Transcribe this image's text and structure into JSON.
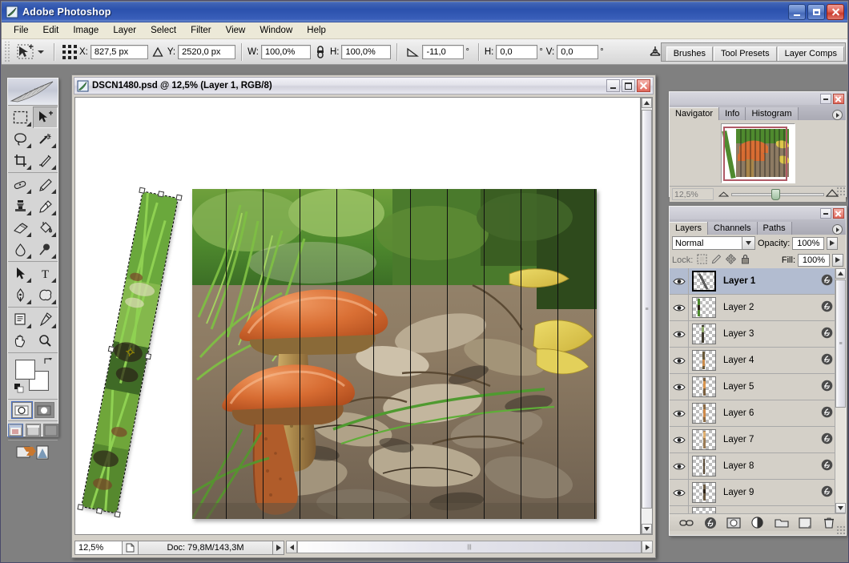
{
  "app": {
    "title": "Adobe Photoshop",
    "icon": "photoshop-feather-icon",
    "window_buttons": {
      "minimize": "_",
      "maximize": "□",
      "close": "✕"
    }
  },
  "menubar": {
    "items": [
      {
        "label": "File"
      },
      {
        "label": "Edit"
      },
      {
        "label": "Image"
      },
      {
        "label": "Layer"
      },
      {
        "label": "Select"
      },
      {
        "label": "Filter"
      },
      {
        "label": "View"
      },
      {
        "label": "Window"
      },
      {
        "label": "Help"
      }
    ]
  },
  "options_bar": {
    "tool_icon": "move-transform-tool-icon",
    "reference_point_icon": "reference-point-grid-icon",
    "x_label": "X:",
    "x_value": "827,5 px",
    "delta_icon": "delta-triangle-icon",
    "y_label": "Y:",
    "y_value": "2520,0 px",
    "w_label": "W:",
    "w_value": "100,0%",
    "link_icon": "chain-link-icon",
    "h_label": "H:",
    "h_value": "100,0%",
    "angle_icon": "rotate-angle-icon",
    "angle_value": "-11,0",
    "angle_unit": "°",
    "skew_h_label": "H:",
    "skew_h_value": "0,0",
    "skew_h_unit": "°",
    "skew_v_label": "V:",
    "skew_v_value": "0,0",
    "skew_v_unit": "°",
    "warp_icon": "warp-mode-icon",
    "cancel_icon": "cancel-transform-icon",
    "commit_icon": "commit-transform-icon",
    "imageready_icon": "jump-to-imageready-icon"
  },
  "palette_well": {
    "tabs": [
      {
        "label": "Brushes"
      },
      {
        "label": "Tool Presets"
      },
      {
        "label": "Layer Comps"
      }
    ]
  },
  "toolbox": {
    "logo_icon": "feather-logo-icon",
    "groups": [
      {
        "tools": [
          {
            "icon": "marquee-tool-icon",
            "selected": false
          },
          {
            "icon": "move-tool-icon",
            "selected": true
          },
          {
            "icon": "lasso-tool-icon",
            "selected": false
          },
          {
            "icon": "magic-wand-tool-icon",
            "selected": false
          },
          {
            "icon": "crop-tool-icon",
            "selected": false
          },
          {
            "icon": "slice-tool-icon",
            "selected": false
          }
        ]
      },
      {
        "tools": [
          {
            "icon": "healing-brush-tool-icon",
            "selected": false
          },
          {
            "icon": "brush-tool-icon",
            "selected": false
          },
          {
            "icon": "clone-stamp-tool-icon",
            "selected": false
          },
          {
            "icon": "history-brush-tool-icon",
            "selected": false
          },
          {
            "icon": "eraser-tool-icon",
            "selected": false
          },
          {
            "icon": "gradient-paint-bucket-tool-icon",
            "selected": false
          },
          {
            "icon": "blur-tool-icon",
            "selected": false
          },
          {
            "icon": "dodge-burn-tool-icon",
            "selected": false
          }
        ]
      },
      {
        "tools": [
          {
            "icon": "path-selection-tool-icon",
            "selected": false
          },
          {
            "icon": "type-tool-icon",
            "selected": false
          },
          {
            "icon": "pen-tool-icon",
            "selected": false
          },
          {
            "icon": "custom-shape-tool-icon",
            "selected": false
          }
        ]
      },
      {
        "tools": [
          {
            "icon": "notes-tool-icon",
            "selected": false
          },
          {
            "icon": "eyedropper-tool-icon",
            "selected": false
          },
          {
            "icon": "hand-tool-icon",
            "selected": false
          },
          {
            "icon": "zoom-tool-icon",
            "selected": false
          }
        ]
      }
    ],
    "colors": {
      "foreground": "#ffffff",
      "background": "#ffffff",
      "swap_icon": "swap-colors-icon",
      "reset_icon": "reset-colors-icon"
    },
    "quickmask": [
      {
        "icon": "standard-mode-icon",
        "active": true
      },
      {
        "icon": "quick-mask-mode-icon",
        "active": false
      }
    ],
    "screenmodes": [
      {
        "icon": "standard-screen-mode-icon",
        "active": true
      },
      {
        "icon": "full-screen-menubar-mode-icon",
        "active": false
      },
      {
        "icon": "full-screen-mode-icon",
        "active": false
      }
    ],
    "imageready_icon": "jump-to-imageready-icon"
  },
  "document": {
    "icon": "psd-file-icon",
    "title": "DSCN1480.psd @ 12,5% (Layer 1, RGB/8)",
    "buttons": {
      "minimize": "_",
      "maximize": "□",
      "close": "✕"
    },
    "statusbar": {
      "zoom": "12,5%",
      "preview_icon": "page-preview-icon",
      "doc_info": "Doc: 79,8M/143,3M",
      "more_icon": "status-menu-arrow-icon"
    },
    "canvas": {
      "slice_count": 11,
      "selected_strip": {
        "rotation_deg": -11,
        "handles": 8,
        "pivot_icon": "transform-pivot-icon"
      }
    }
  },
  "navigator_palette": {
    "tabs": [
      {
        "label": "Navigator",
        "active": true
      },
      {
        "label": "Info",
        "active": false
      },
      {
        "label": "Histogram",
        "active": false
      }
    ],
    "menu_icon": "palette-menu-icon",
    "zoom_value": "12,5%",
    "zoom_out_icon": "zoom-out-small-icon",
    "zoom_in_icon": "zoom-in-large-icon",
    "view_box_color": "#b05a66"
  },
  "layers_palette": {
    "tabs": [
      {
        "label": "Layers",
        "active": true
      },
      {
        "label": "Channels",
        "active": false
      },
      {
        "label": "Paths",
        "active": false
      }
    ],
    "menu_icon": "palette-menu-icon",
    "blend_mode": "Normal",
    "blend_dropdown_icon": "chevron-down-icon",
    "opacity_label": "Opacity:",
    "opacity_value": "100%",
    "lock_label": "Lock:",
    "lock_icons": [
      {
        "icon": "lock-transparency-icon"
      },
      {
        "icon": "lock-image-icon"
      },
      {
        "icon": "lock-position-icon"
      },
      {
        "icon": "lock-all-icon"
      }
    ],
    "fill_label": "Fill:",
    "fill_value": "100%",
    "layers": [
      {
        "name": "Layer 1",
        "visible": true,
        "selected": true,
        "has_fx": true
      },
      {
        "name": "Layer 2",
        "visible": true,
        "selected": false,
        "has_fx": true
      },
      {
        "name": "Layer 3",
        "visible": true,
        "selected": false,
        "has_fx": true
      },
      {
        "name": "Layer 4",
        "visible": true,
        "selected": false,
        "has_fx": true
      },
      {
        "name": "Layer 5",
        "visible": true,
        "selected": false,
        "has_fx": true
      },
      {
        "name": "Layer 6",
        "visible": true,
        "selected": false,
        "has_fx": true
      },
      {
        "name": "Layer 7",
        "visible": true,
        "selected": false,
        "has_fx": true
      },
      {
        "name": "Layer 8",
        "visible": true,
        "selected": false,
        "has_fx": true
      },
      {
        "name": "Layer 9",
        "visible": true,
        "selected": false,
        "has_fx": true
      }
    ],
    "footer_buttons": [
      {
        "icon": "link-layers-icon"
      },
      {
        "icon": "layer-style-fx-icon"
      },
      {
        "icon": "add-layer-mask-icon"
      },
      {
        "icon": "new-adjustment-layer-icon"
      },
      {
        "icon": "new-group-icon"
      },
      {
        "icon": "new-layer-icon"
      },
      {
        "icon": "delete-layer-icon"
      }
    ]
  }
}
